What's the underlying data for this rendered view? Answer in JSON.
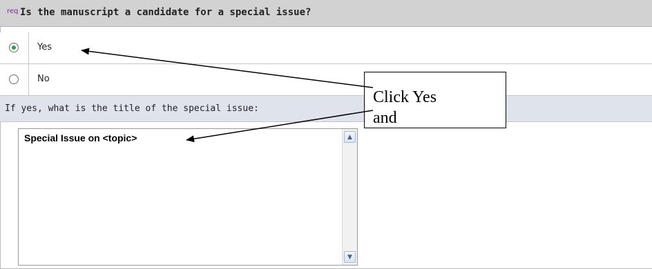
{
  "question": {
    "req_badge": "req",
    "title": "Is the manuscript a candidate for a special issue?"
  },
  "options": [
    {
      "label": "Yes",
      "selected": true
    },
    {
      "label": "No",
      "selected": false
    }
  ],
  "followup": {
    "label": "If yes, what is the title of the special issue:",
    "value": "Special Issue on <topic>"
  },
  "annotation": {
    "text": "Click Yes\nand"
  },
  "colors": {
    "header_bg": "#d2d2d2",
    "section_bg": "#dfe3ec",
    "radio_selected": "#2aa34a",
    "req_badge": "#7b2a9b"
  },
  "icons": {
    "scroll_up": "triangle-up",
    "scroll_down": "triangle-down"
  }
}
